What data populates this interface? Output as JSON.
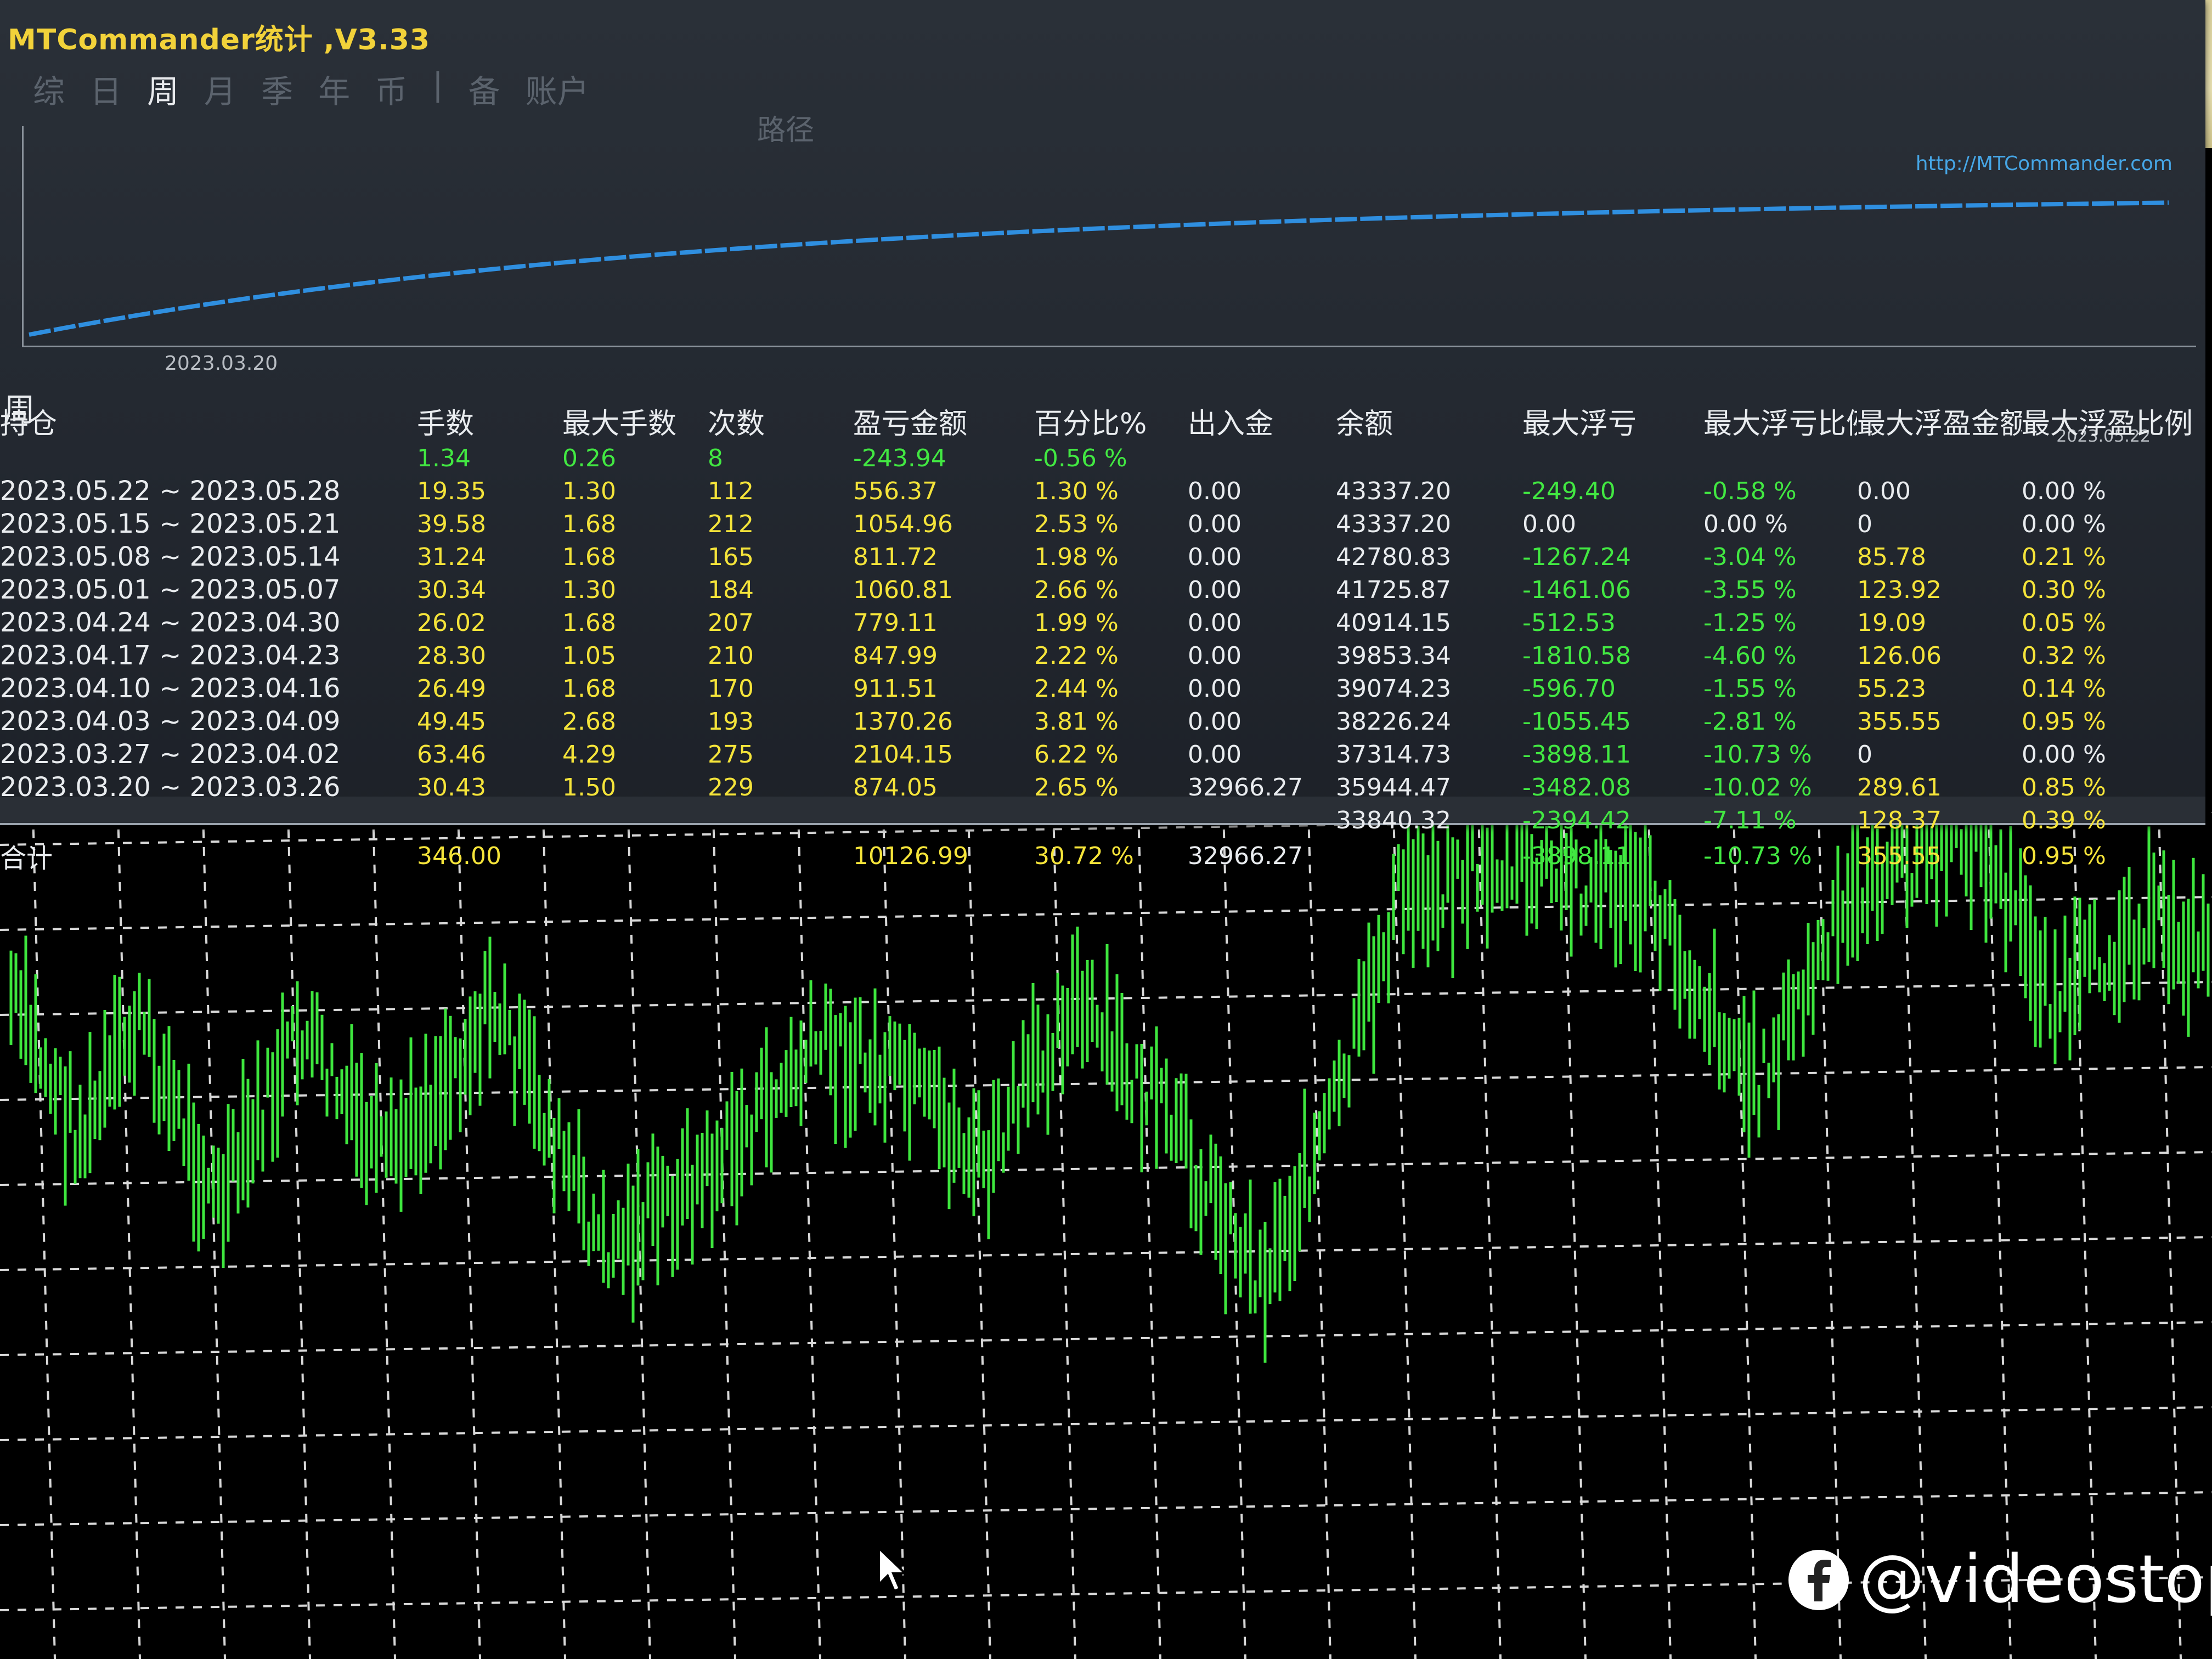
{
  "app": {
    "title": "MTCommander统计 ,V3.33",
    "site": "http://MTCommander.com",
    "path_label": "路径"
  },
  "tabs": [
    {
      "label": "综",
      "active": false
    },
    {
      "label": "日",
      "active": false
    },
    {
      "label": "周",
      "active": true
    },
    {
      "label": "月",
      "active": false
    },
    {
      "label": "季",
      "active": false
    },
    {
      "label": "年",
      "active": false
    },
    {
      "label": "币",
      "active": false
    },
    {
      "label": "|",
      "active": false
    },
    {
      "label": "备",
      "active": false
    },
    {
      "label": "账户",
      "active": false
    }
  ],
  "balance_chart": {
    "start_label": "2023.03.20",
    "end_label": "2023.05.22",
    "line_color": "#2f8fe0"
  },
  "table": {
    "period_label": "周",
    "headers": [
      "持仓",
      "手数",
      "最大手数",
      "次数",
      "盈亏金额",
      "百分比%",
      "出入金",
      "余额",
      "最大浮亏",
      "最大浮亏比例",
      "最大浮盈金额",
      "最大浮盈比例"
    ],
    "holding": [
      "",
      "1.34",
      "0.26",
      "8",
      "-243.94",
      "-0.56 %",
      "",
      "",
      "",
      "",
      "",
      ""
    ],
    "rows": [
      [
        "2023.05.22 ~ 2023.05.28",
        "19.35",
        "1.30",
        "112",
        "556.37",
        "1.30 %",
        "0.00",
        "43337.20",
        "-249.40",
        "-0.58 %",
        "0.00",
        "0.00 %"
      ],
      [
        "2023.05.15 ~ 2023.05.21",
        "39.58",
        "1.68",
        "212",
        "1054.96",
        "2.53 %",
        "0.00",
        "43337.20",
        "0.00",
        "0.00 %",
        "0",
        "0.00 %"
      ],
      [
        "2023.05.08 ~ 2023.05.14",
        "31.24",
        "1.68",
        "165",
        "811.72",
        "1.98 %",
        "0.00",
        "42780.83",
        "-1267.24",
        "-3.04 %",
        "85.78",
        "0.21 %"
      ],
      [
        "2023.05.01 ~ 2023.05.07",
        "30.34",
        "1.30",
        "184",
        "1060.81",
        "2.66 %",
        "0.00",
        "41725.87",
        "-1461.06",
        "-3.55 %",
        "123.92",
        "0.30 %"
      ],
      [
        "2023.04.24 ~ 2023.04.30",
        "26.02",
        "1.68",
        "207",
        "779.11",
        "1.99 %",
        "0.00",
        "40914.15",
        "-512.53",
        "-1.25 %",
        "19.09",
        "0.05 %"
      ],
      [
        "2023.04.17 ~ 2023.04.23",
        "28.30",
        "1.05",
        "210",
        "847.99",
        "2.22 %",
        "0.00",
        "39853.34",
        "-1810.58",
        "-4.60 %",
        "126.06",
        "0.32 %"
      ],
      [
        "2023.04.10 ~ 2023.04.16",
        "26.49",
        "1.68",
        "170",
        "911.51",
        "2.44 %",
        "0.00",
        "39074.23",
        "-596.70",
        "-1.55 %",
        "55.23",
        "0.14 %"
      ],
      [
        "2023.04.03 ~ 2023.04.09",
        "49.45",
        "2.68",
        "193",
        "1370.26",
        "3.81 %",
        "0.00",
        "38226.24",
        "-1055.45",
        "-2.81 %",
        "355.55",
        "0.95 %"
      ],
      [
        "2023.03.27 ~ 2023.04.02",
        "63.46",
        "4.29",
        "275",
        "2104.15",
        "6.22 %",
        "0.00",
        "37314.73",
        "-3898.11",
        "-10.73 %",
        "0",
        "0.00 %"
      ],
      [
        "2023.03.20 ~ 2023.03.26",
        "30.43",
        "1.50",
        "229",
        "874.05",
        "2.65 %",
        "32966.27",
        "35944.47",
        "-3482.08",
        "-10.02 %",
        "289.61",
        "0.85 %"
      ],
      [
        "",
        "",
        "",
        "",
        "",
        "",
        "",
        "33840.32",
        "-2394.42",
        "-7.11 %",
        "128.37",
        "0.39 %"
      ]
    ],
    "total": [
      "合计",
      "346.00",
      "",
      "",
      "10126.99",
      "30.72 %",
      "32966.27",
      "",
      "-3898.11",
      "-10.73 %",
      "355.55",
      "0.95 %"
    ]
  },
  "watermark": "@videostop",
  "colors": {
    "positive": "#f5e43a",
    "negative": "#42e842",
    "chart_up": "#3ee63e",
    "panel_bg": "#252a31"
  }
}
